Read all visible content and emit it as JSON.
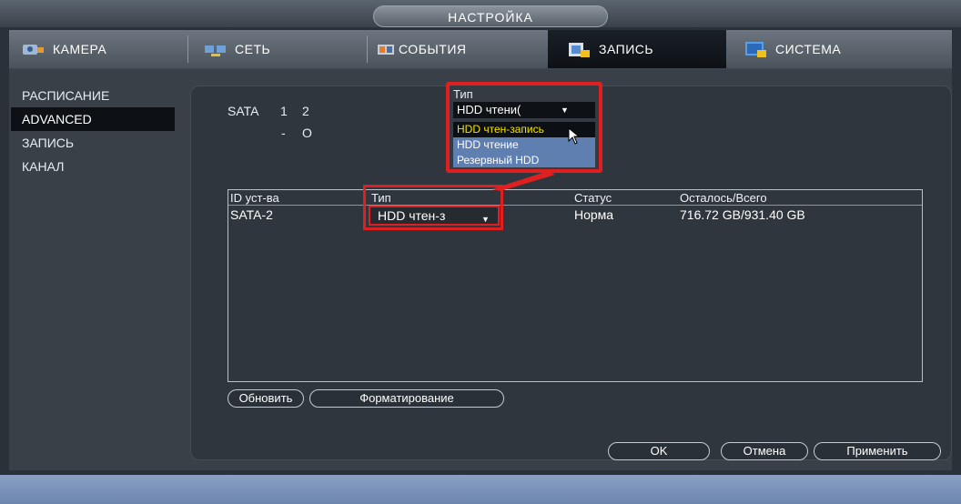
{
  "window_title": "НАСТРОЙКА",
  "tabs": [
    {
      "label": "КАМЕРА",
      "icon": "camera-icon"
    },
    {
      "label": "СЕТЬ",
      "icon": "network-icon"
    },
    {
      "label": "СОБЫТИЯ",
      "icon": "events-icon"
    },
    {
      "label": "ЗАПИСЬ",
      "icon": "record-icon",
      "active": true
    },
    {
      "label": "СИСТЕМА",
      "icon": "system-icon"
    }
  ],
  "sidebar": {
    "items": [
      {
        "label": "РАСПИСАНИЕ"
      },
      {
        "label": "ADVANCED",
        "active": true
      },
      {
        "label": "ЗАПИСЬ"
      },
      {
        "label": "КАНАЛ"
      }
    ]
  },
  "sata": {
    "label": "SATA",
    "ports": [
      "1",
      "2"
    ],
    "status": [
      "-",
      "O"
    ]
  },
  "popup": {
    "title": "Тип",
    "selected": "HDD чтени(",
    "options": [
      "HDD чтен-запись",
      "HDD чтение",
      "Резервный HDD"
    ]
  },
  "table": {
    "headers": [
      "ID уст-ва",
      "Тип",
      "Статус",
      "Осталось/Всего"
    ],
    "rows": [
      {
        "device": "SATA-2",
        "type": "HDD чтен-з",
        "status": "Норма",
        "space": "716.72 GB/931.40 GB"
      }
    ]
  },
  "buttons": {
    "refresh": "Обновить",
    "format": "Форматирование",
    "ok": "OK",
    "cancel": "Отмена",
    "apply": "Применить"
  },
  "colors": {
    "accent_red": "#e02020",
    "highlight_text": "#f3e300",
    "list_blue": "#5f7fb0"
  }
}
